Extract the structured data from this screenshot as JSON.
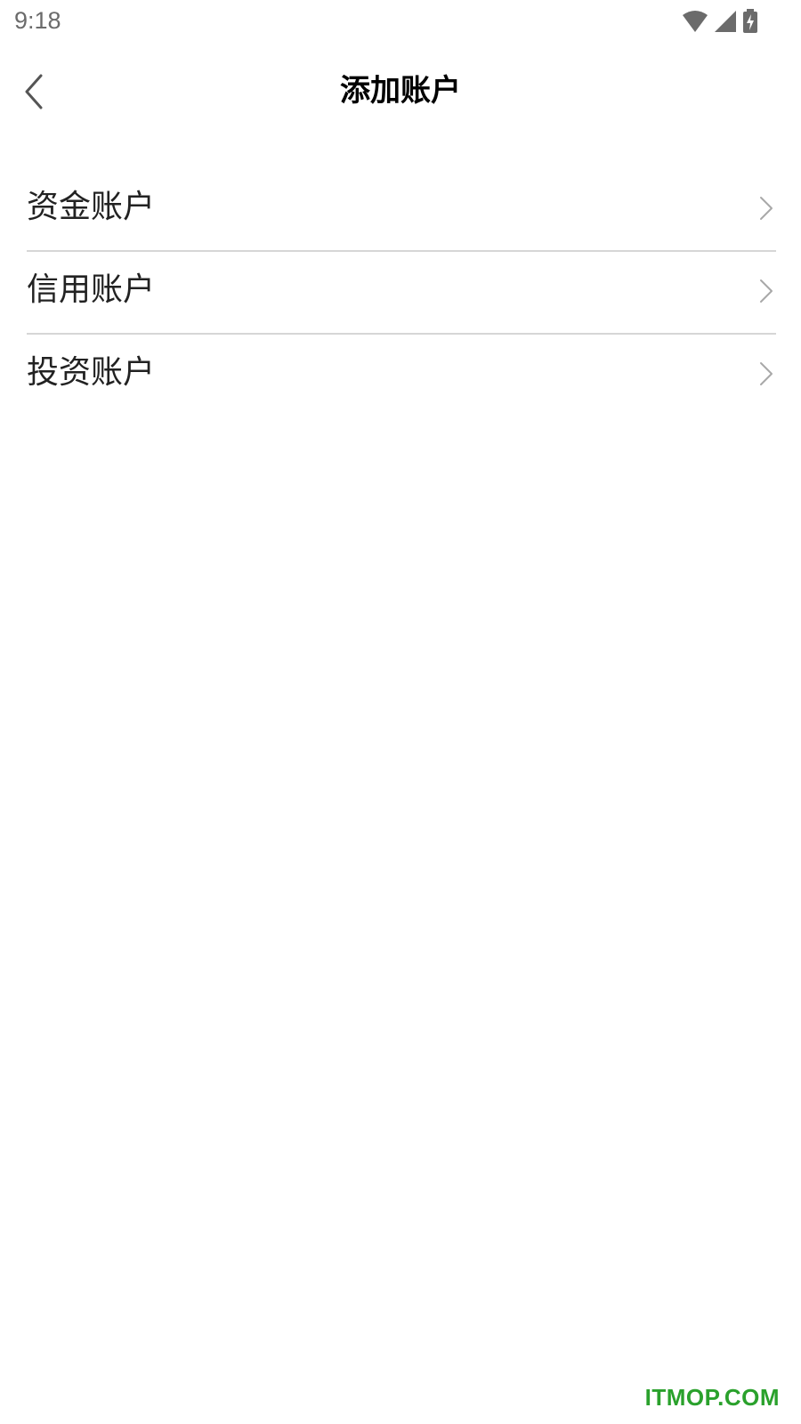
{
  "status_bar": {
    "time": "9:18",
    "icons": [
      "wifi-icon",
      "cellular-signal-icon",
      "battery-charging-icon"
    ],
    "icon_color": "#6b6b6b"
  },
  "nav": {
    "title": "添加账户",
    "back_icon": "chevron-left-icon"
  },
  "accounts": {
    "items": [
      {
        "label": "资金账户",
        "icon": "chevron-right-icon"
      },
      {
        "label": "信用账户",
        "icon": "chevron-right-icon"
      },
      {
        "label": "投资账户",
        "icon": "chevron-right-icon"
      }
    ],
    "divider_color": "#d6d6d6",
    "chevron_color": "#a8a8a8"
  },
  "watermark": {
    "text": "ITMOP.COM",
    "color": "#2aa12c"
  }
}
